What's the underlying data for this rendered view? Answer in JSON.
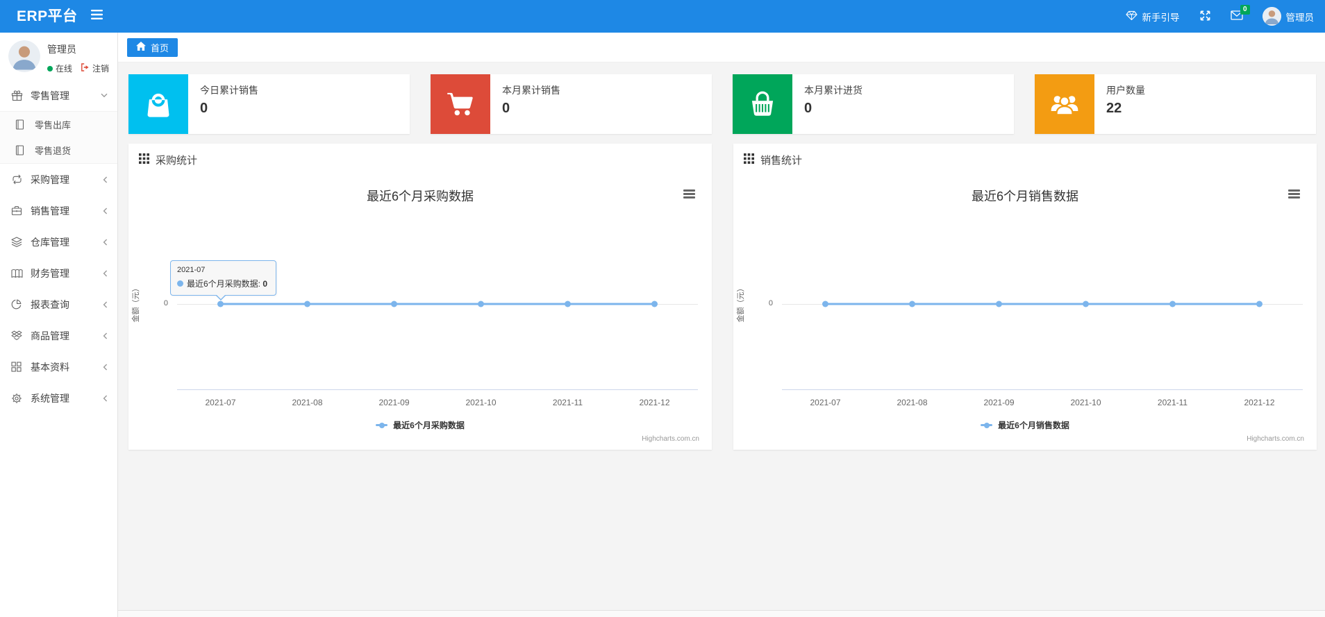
{
  "colors": {
    "navbar_blue": "#1e88e5",
    "line_color": "#7cb5ec",
    "badge_green": "#00a65a",
    "logout_red": "#dd4b39"
  },
  "navbar": {
    "brand": "ERP平台",
    "menu_icon": "hamburger-icon",
    "guide_label": "新手引导",
    "guide_icon": "gem-icon",
    "fullscreen_icon": "fullscreen-icon",
    "mail_icon": "envelope-icon",
    "mail_badge": "0",
    "user_name": "管理员"
  },
  "sidebar": {
    "user_name": "管理员",
    "status_online": "在线",
    "logout_label": "注销",
    "menu": [
      {
        "icon": "gift-icon",
        "label": "零售管理",
        "expanded": true,
        "children": [
          {
            "icon": "journal-icon",
            "label": "零售出库"
          },
          {
            "icon": "journal-icon",
            "label": "零售退货"
          }
        ]
      },
      {
        "icon": "repeat-icon",
        "label": "采购管理",
        "expanded": false
      },
      {
        "icon": "briefcase-icon",
        "label": "销售管理",
        "expanded": false
      },
      {
        "icon": "layers-icon",
        "label": "仓库管理",
        "expanded": false
      },
      {
        "icon": "ledger-icon",
        "label": "财务管理",
        "expanded": false
      },
      {
        "icon": "pie-chart-icon",
        "label": "报表查询",
        "expanded": false
      },
      {
        "icon": "box-icon",
        "label": "商品管理",
        "expanded": false
      },
      {
        "icon": "grid-icon",
        "label": "基本资料",
        "expanded": false
      },
      {
        "icon": "gear-icon",
        "label": "系统管理",
        "expanded": false
      }
    ]
  },
  "breadcrumb": {
    "home_icon": "home-icon",
    "home_label": "首页"
  },
  "stat_cards": [
    {
      "icon": "shopping-bag-icon",
      "color": "#00c0ef",
      "label": "今日累计销售",
      "value": "0"
    },
    {
      "icon": "shopping-cart-icon",
      "color": "#dd4b39",
      "label": "本月累计销售",
      "value": "0"
    },
    {
      "icon": "shopping-basket-icon",
      "color": "#00a65a",
      "label": "本月累计进货",
      "value": "0"
    },
    {
      "icon": "users-icon",
      "color": "#f39c12",
      "label": "用户数量",
      "value": "22"
    }
  ],
  "chart_data": [
    {
      "type": "line",
      "panel_title": "采购统计",
      "title": "最近6个月采购数据",
      "categories": [
        "2021-07",
        "2021-08",
        "2021-09",
        "2021-10",
        "2021-11",
        "2021-12"
      ],
      "series": [
        {
          "name": "最近6个月采购数据",
          "values": [
            0,
            0,
            0,
            0,
            0,
            0
          ]
        }
      ],
      "xlabel": "",
      "ylabel": "金额（元）",
      "yticks": [
        "0"
      ],
      "grid": true,
      "legend_position": "bottom",
      "line_color": "#7cb5ec",
      "credits": "Highcharts.com.cn",
      "tooltip": {
        "header": "2021-07",
        "series": "最近6个月采购数据",
        "value": "0"
      }
    },
    {
      "type": "line",
      "panel_title": "销售统计",
      "title": "最近6个月销售数据",
      "categories": [
        "2021-07",
        "2021-08",
        "2021-09",
        "2021-10",
        "2021-11",
        "2021-12"
      ],
      "series": [
        {
          "name": "最近6个月销售数据",
          "values": [
            0,
            0,
            0,
            0,
            0,
            0
          ]
        }
      ],
      "xlabel": "",
      "ylabel": "金额（元）",
      "yticks": [
        "0"
      ],
      "grid": true,
      "legend_position": "bottom",
      "line_color": "#7cb5ec",
      "credits": "Highcharts.com.cn",
      "tooltip": null
    }
  ],
  "footer": {
    "text": ""
  }
}
